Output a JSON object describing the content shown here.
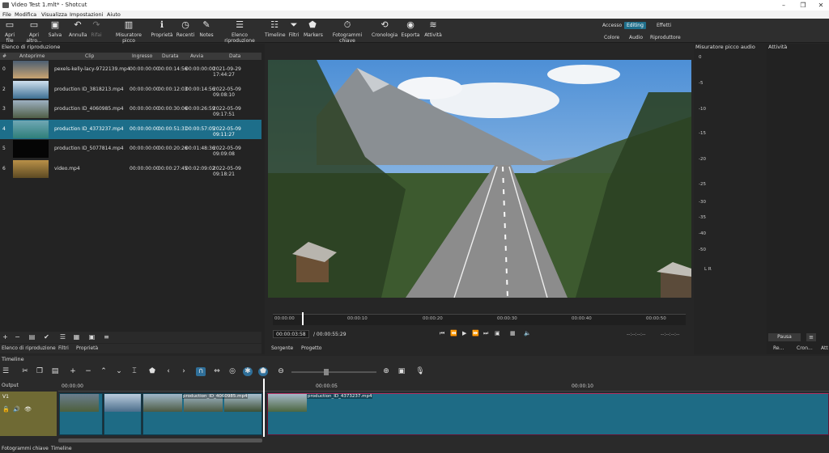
{
  "window": {
    "title": "Video Test 1.mlt* - Shotcut"
  },
  "menu": [
    "File",
    "Modifica",
    "Visualizza",
    "Impostazioni",
    "Aiuto"
  ],
  "toolbar": [
    {
      "label": "Apri file",
      "icon": "folder-open-icon"
    },
    {
      "label": "Apri altro...",
      "icon": "folder-icon"
    },
    {
      "label": "Salva",
      "icon": "save-icon"
    },
    {
      "label": "Annulla",
      "icon": "undo-icon"
    },
    {
      "label": "Rifai",
      "icon": "redo-icon"
    },
    {
      "label": "Misuratore picco",
      "icon": "meter-icon"
    },
    {
      "label": "Proprietà",
      "icon": "info-icon"
    },
    {
      "label": "Recenti",
      "icon": "clock-icon"
    },
    {
      "label": "Notes",
      "icon": "notes-icon"
    },
    {
      "label": "Elenco riproduzione",
      "icon": "list-icon"
    },
    {
      "label": "Timeline",
      "icon": "timeline-icon"
    },
    {
      "label": "Filtri",
      "icon": "filter-icon"
    },
    {
      "label": "Markers",
      "icon": "marker-icon"
    },
    {
      "label": "Fotogrammi chiave",
      "icon": "stopwatch-icon"
    },
    {
      "label": "Cronologia",
      "icon": "history-icon"
    },
    {
      "label": "Esporta",
      "icon": "export-icon"
    },
    {
      "label": "Attività",
      "icon": "jobs-icon"
    }
  ],
  "workspaces": {
    "accesso": "Accesso",
    "editing": "Editing",
    "effetti": "Effetti",
    "colore": "Colore",
    "audio": "Audio",
    "riproduttore": "Riproduttore"
  },
  "playlist": {
    "title": "Elenco di riproduzione",
    "columns": [
      "#",
      "Anteprime",
      "Clip",
      "Ingresso",
      "Durata",
      "Avvia",
      "Data"
    ],
    "rows": [
      {
        "num": "0",
        "clip": "pexels-kelly-lacy-9722139.mp4",
        "in": "00:00:00:00",
        "dur": "00:00:14:56",
        "start": "00:00:00:00",
        "date": "2021-09-29 17:44:27"
      },
      {
        "num": "2",
        "clip": "production ID_3818213.mp4",
        "in": "00:00:00:00",
        "dur": "00:00:12:03",
        "start": "00:00:14:56",
        "date": "2022-05-09 09:08:10"
      },
      {
        "num": "3",
        "clip": "production ID_4060985.mp4",
        "in": "00:00:00:00",
        "dur": "00:00:30:06",
        "start": "00:00:26:59",
        "date": "2022-05-09 09:17:51"
      },
      {
        "num": "4",
        "clip": "production ID_4373237.mp4",
        "in": "00:00:00:00",
        "dur": "00:00:51:31",
        "start": "00:00:57:05",
        "date": "2022-05-09 09:11:27"
      },
      {
        "num": "5",
        "clip": "production ID_5077814.mp4",
        "in": "00:00:00:00",
        "dur": "00:00:20:26",
        "start": "00:01:48:36",
        "date": "2022-05-09 09:09:08"
      },
      {
        "num": "6",
        "clip": "video.mp4",
        "in": "00:00:00:00",
        "dur": "00:00:27:45",
        "start": "00:02:09:02",
        "date": "2022-05-09 09:18:21"
      }
    ],
    "selected_row": 3,
    "tabs": [
      "Elenco di riproduzione",
      "Filtri",
      "Proprietà"
    ]
  },
  "viewer": {
    "ruler_ticks": [
      "00:00:00",
      "00:00:10",
      "00:00:20",
      "00:00:30",
      "00:00:40",
      "00:00:50"
    ],
    "position": "00:00:03:58",
    "duration": "/ 00:00:55:29",
    "inpoint": "--:--:--:--",
    "outpoint": "--:--:--:--",
    "tabs": [
      "Sorgente",
      "Progetto"
    ]
  },
  "meter": {
    "title": "Misuratore picco audio",
    "scale": [
      "0",
      "-5",
      "-10",
      "-15",
      "-20",
      "-25",
      "-30",
      "-35",
      "-40",
      "-50"
    ],
    "channels": "L  R"
  },
  "activity": {
    "title": "Attività",
    "pause": "Pausa",
    "left_btn": "Re...",
    "mid_btn": "Cron...",
    "right_btn": "Att"
  },
  "timeline": {
    "title": "Timeline",
    "ruler": [
      "00:00:00",
      "00:00:05",
      "00:00:10"
    ],
    "output_label": "Output",
    "track_name": "V1",
    "clip_labels": [
      "production_ID_4060985.mp4",
      "production_ID_4373237.mp4"
    ],
    "bottom_tabs": [
      "Fotogrammi chiave",
      "Timeline"
    ]
  }
}
